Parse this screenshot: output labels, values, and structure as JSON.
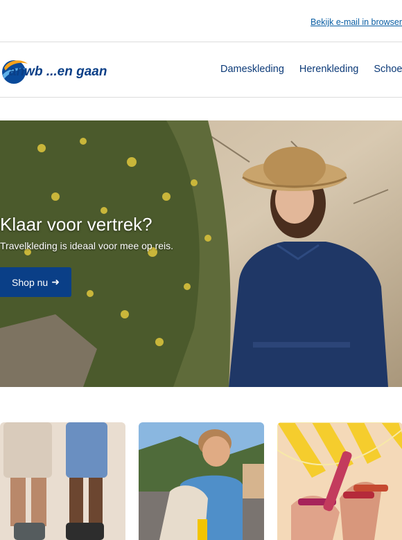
{
  "header": {
    "browser_link": "Bekijk e-mail in browser",
    "logo_text": "anwb ...en gaan"
  },
  "nav": {
    "items": [
      {
        "label": "Dameskleding"
      },
      {
        "label": "Herenkleding"
      },
      {
        "label": "Schoenen"
      }
    ]
  },
  "hero": {
    "title": "Klaar voor vertrek?",
    "subtitle": "Travelkleding is ideaal voor mee op reis.",
    "button_label": "Shop nu",
    "button_icon": "arrow-right-icon"
  },
  "colors": {
    "brand_blue": "#0a3f87",
    "link_blue": "#0b5fa4",
    "nav_blue": "#0c3a78",
    "logo_orange": "#f7a21b"
  }
}
